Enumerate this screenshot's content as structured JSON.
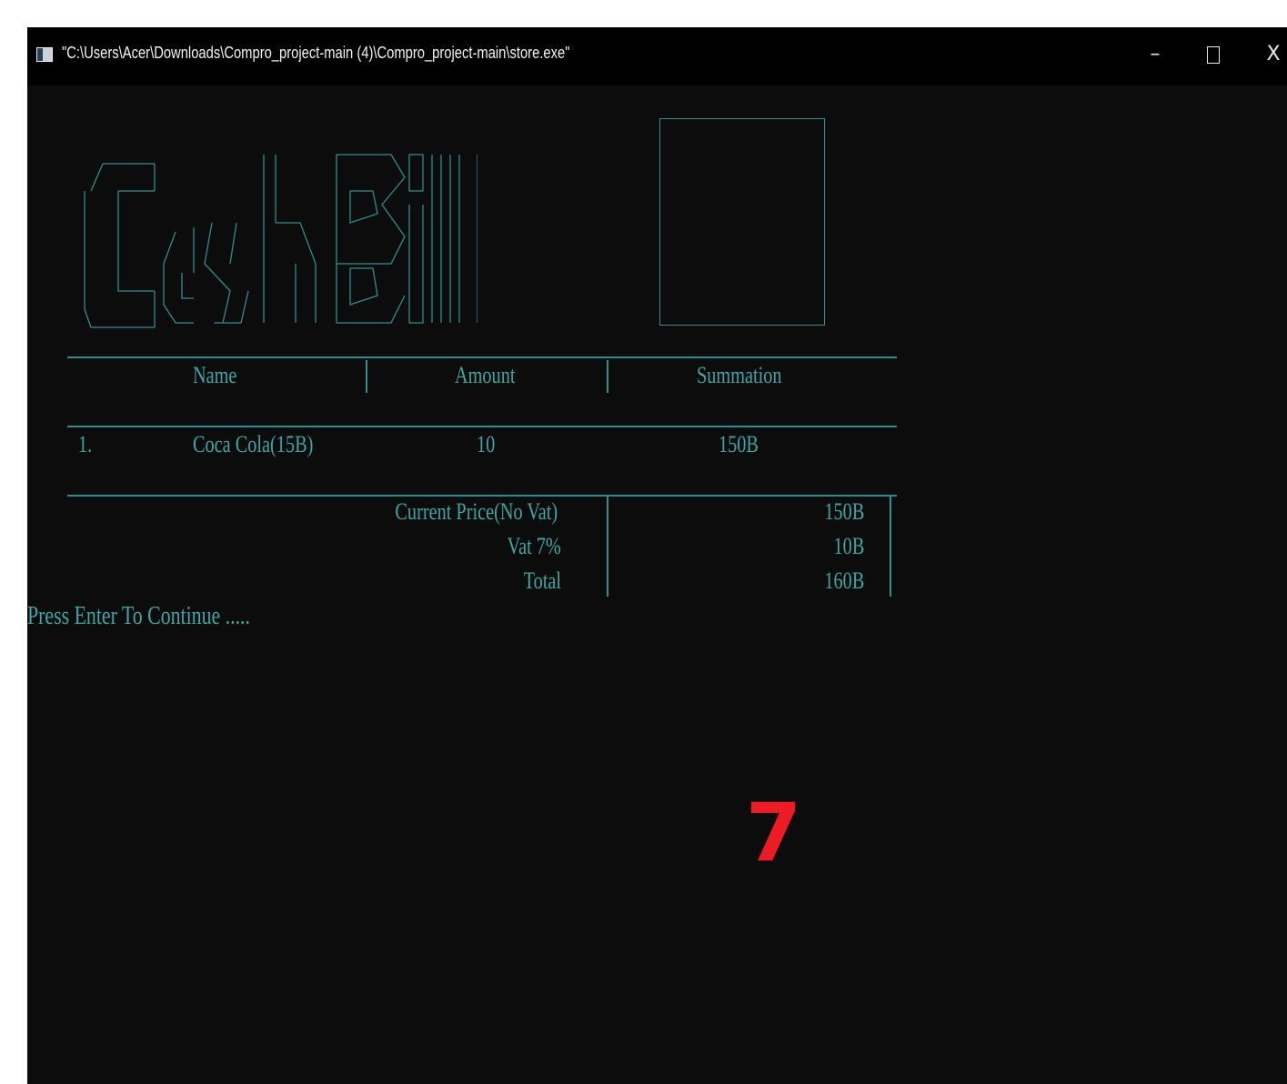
{
  "window": {
    "title": "\"C:\\Users\\Acer\\Downloads\\Compro_project-main (4)\\Compro_project-main\\store.exe\"",
    "controls": {
      "minimize": "–",
      "close": "X"
    }
  },
  "bill": {
    "headers": {
      "name": "Name",
      "amount": "Amount",
      "summation": "Summation"
    },
    "items": [
      {
        "index": "1.",
        "name": "Coca Cola(15B)",
        "amount": "10",
        "summation": "150B"
      }
    ],
    "totals": {
      "current_price_label": "Current Price(No Vat)",
      "current_price_value": "150B",
      "vat_label": "Vat 7%",
      "vat_value": "10B",
      "total_label": "Total",
      "total_value": "160B"
    }
  },
  "prompt": "Press Enter To Continue .....",
  "overlay_marker": "7",
  "colors": {
    "console_bg": "#0c0c0c",
    "text_cyan": "#3ea6a6",
    "marker_red": "#ed1c24"
  }
}
